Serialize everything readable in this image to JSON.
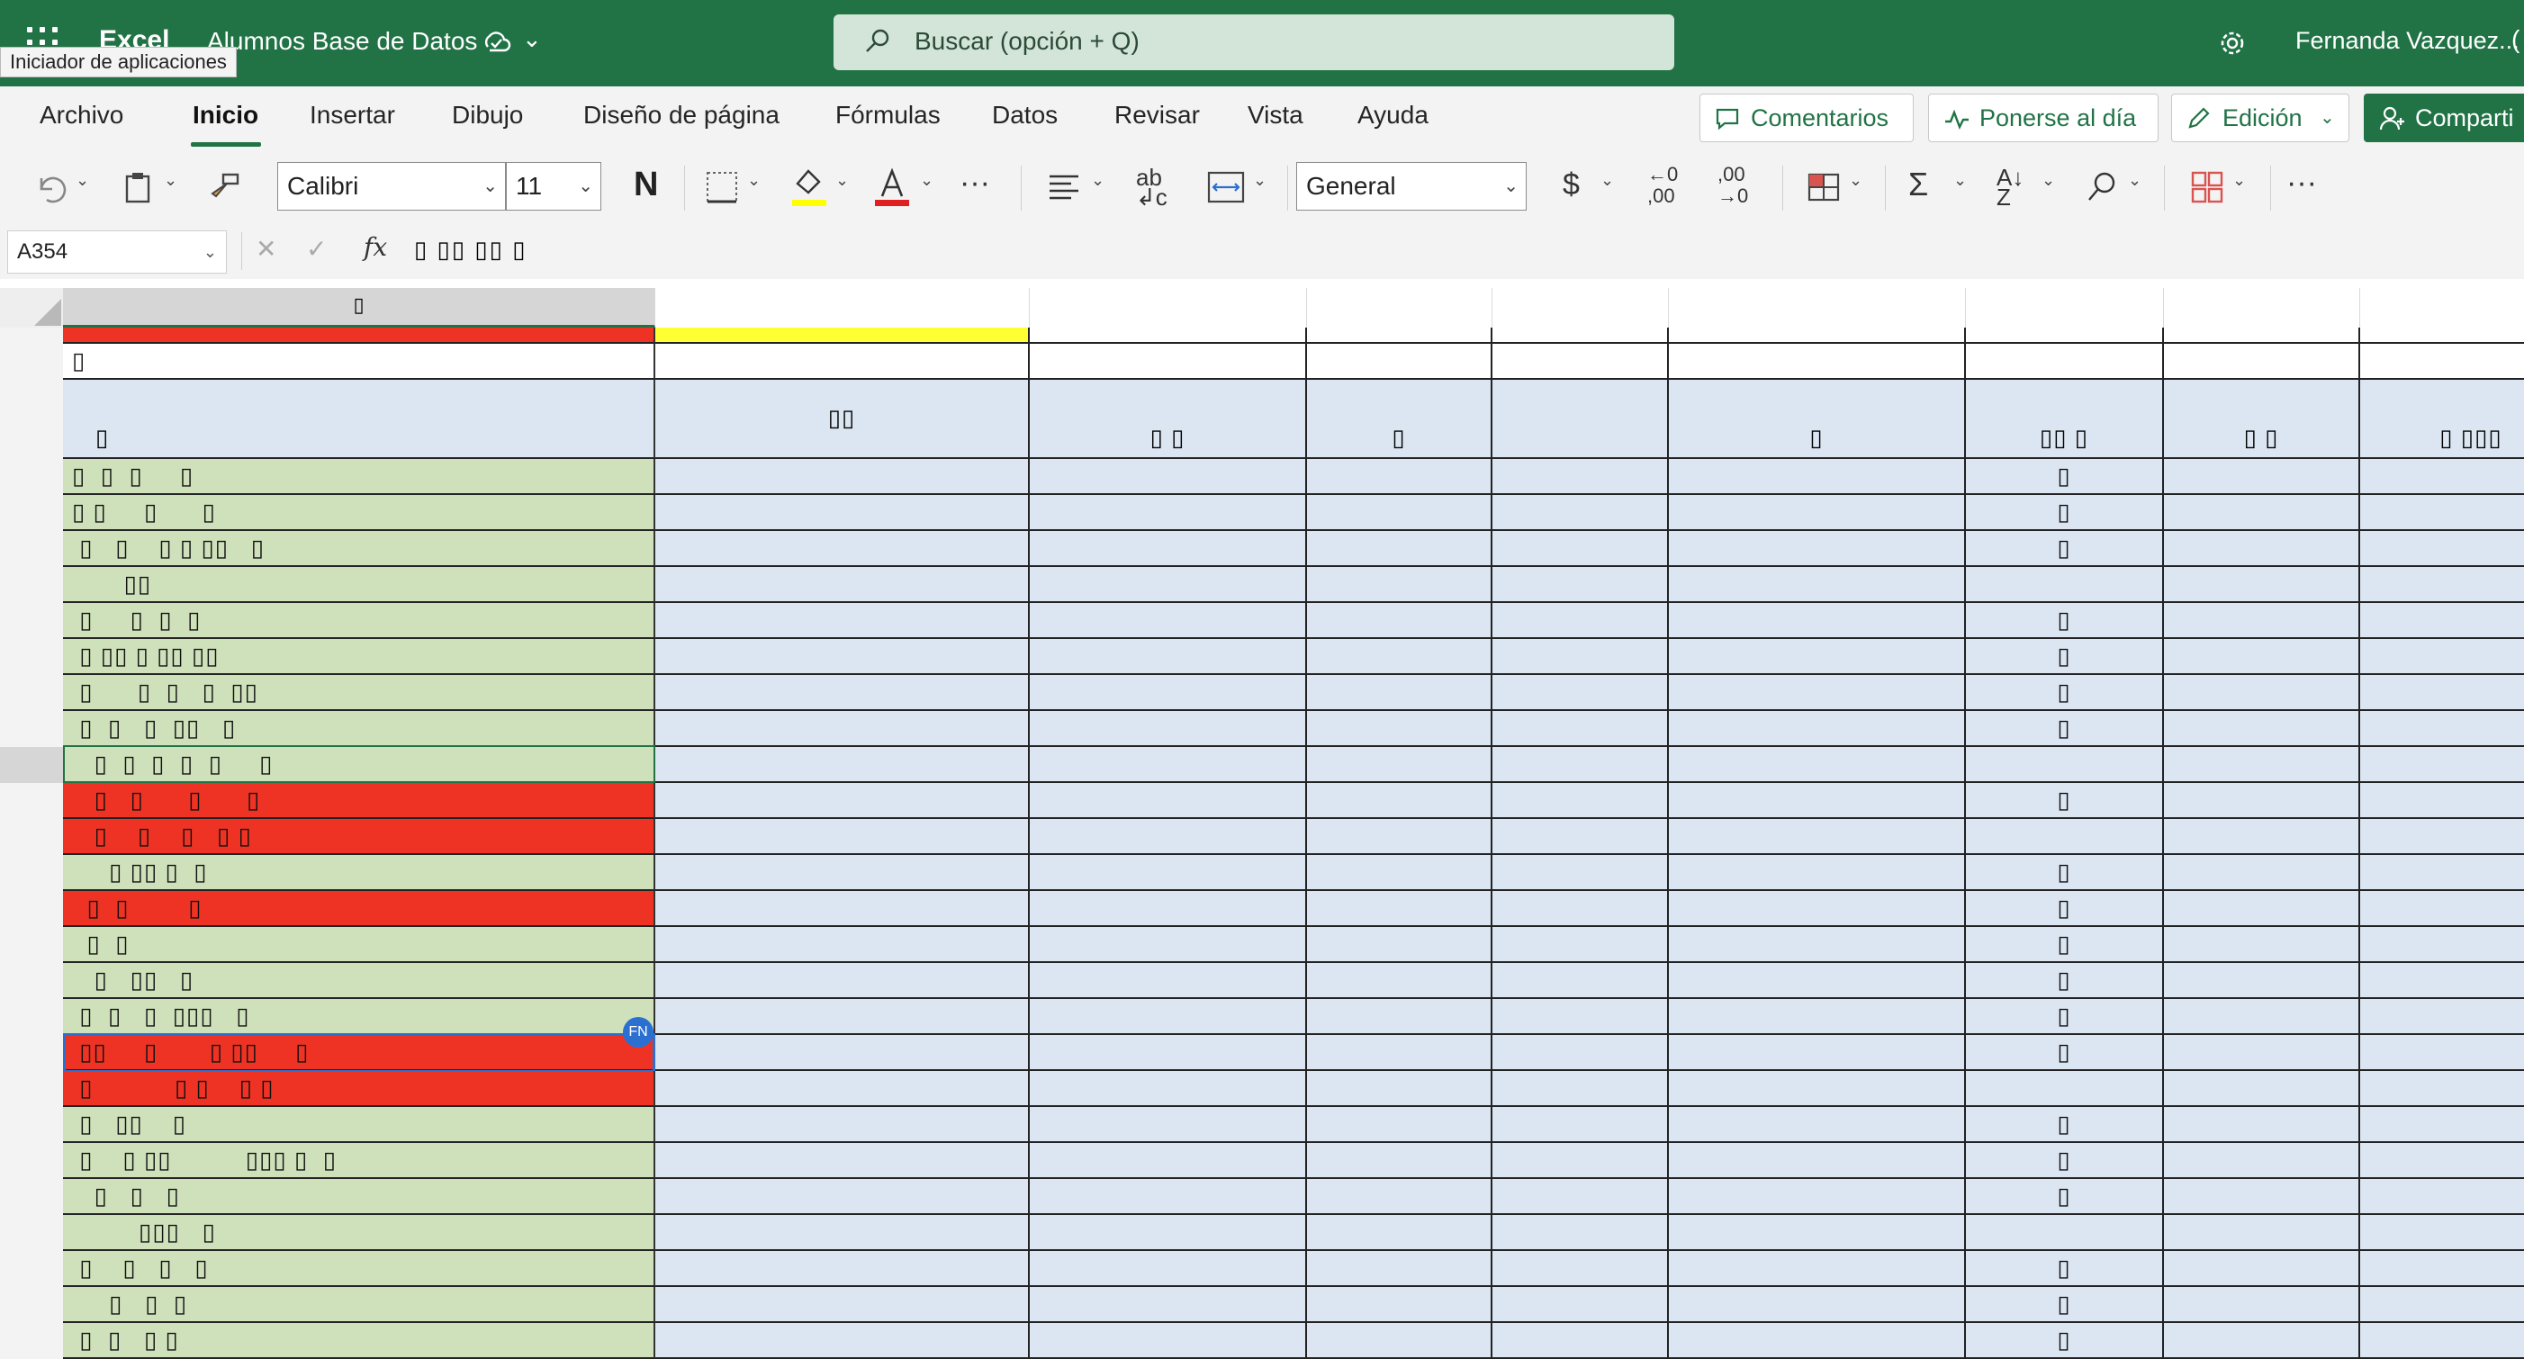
{
  "app": {
    "name": "Excel",
    "document_title": "Alumnos Base de Datos",
    "launcher_tooltip": "Iniciador de aplicaciones",
    "search_placeholder": "Buscar (opción + Q)",
    "user_name": "Fernanda Vazquez...",
    "user_paren": "(",
    "brand_color": "#217346"
  },
  "ribbon": {
    "tabs": [
      "Archivo",
      "Inicio",
      "Insertar",
      "Dibujo",
      "Diseño de página",
      "Fórmulas",
      "Datos",
      "Revisar",
      "Vista",
      "Ayuda"
    ],
    "active_tab": "Inicio",
    "comments_label": "Comentarios",
    "catchup_label": "Ponerse al día",
    "editing_label": "Edición",
    "share_label": "Comparti"
  },
  "toolbar": {
    "font_name": "Calibri",
    "font_size": "11",
    "bold_label": "N",
    "number_format": "General",
    "currency_symbol": "$",
    "increase_decimal": "←0\n,00",
    "decrease_decimal": ",00\n→0",
    "more_label": "···",
    "fill_color": "#ffff00",
    "font_color": "#e02020"
  },
  "formula_bar": {
    "name_box": "A354",
    "fx_label": "fx",
    "content": "▯ ▯▯ ▯▯ ▯"
  },
  "sheet": {
    "colors": {
      "green": "#cfe1bb",
      "red": "#ee3324",
      "blue": "#dce6f2",
      "yellow": "#ffff33",
      "white": "#ffffff"
    },
    "col_a_header_glyph": "▯",
    "title_row_glyph": "▯",
    "header_row": [
      "▯",
      "▯▯",
      "▯ ▯",
      "▯",
      "",
      "▯",
      "▯▯ ▯",
      "▯ ▯",
      "▯ ▯▯▯"
    ],
    "rows": [
      {
        "fill": "green",
        "a": "▯  ▯  ▯     ▯",
        "g": "▯"
      },
      {
        "fill": "green",
        "a": "▯ ▯     ▯      ▯",
        "g": "▯"
      },
      {
        "fill": "green",
        "a": " ▯   ▯    ▯ ▯ ▯▯   ▯",
        "g": "▯"
      },
      {
        "fill": "green",
        "a": "       ▯▯",
        "g": ""
      },
      {
        "fill": "green",
        "a": " ▯     ▯  ▯  ▯",
        "g": "▯"
      },
      {
        "fill": "green",
        "a": " ▯ ▯▯ ▯ ▯▯ ▯▯",
        "g": "▯"
      },
      {
        "fill": "green",
        "a": " ▯      ▯  ▯   ▯  ▯▯",
        "g": "▯"
      },
      {
        "fill": "green",
        "a": " ▯  ▯   ▯  ▯▯   ▯",
        "g": "▯"
      },
      {
        "fill": "green",
        "a": "   ▯  ▯  ▯  ▯  ▯     ▯",
        "g": ""
      },
      {
        "fill": "red",
        "a": "   ▯   ▯      ▯      ▯",
        "g": "▯"
      },
      {
        "fill": "red",
        "a": "   ▯    ▯    ▯   ▯ ▯",
        "g": ""
      },
      {
        "fill": "green",
        "a": "     ▯ ▯▯ ▯  ▯",
        "g": "▯"
      },
      {
        "fill": "red",
        "a": "  ▯  ▯        ▯",
        "g": "▯"
      },
      {
        "fill": "green",
        "a": "  ▯  ▯",
        "g": "▯"
      },
      {
        "fill": "green",
        "a": "   ▯   ▯▯   ▯",
        "g": "▯"
      },
      {
        "fill": "green",
        "a": " ▯  ▯   ▯  ▯▯▯   ▯",
        "g": "▯"
      },
      {
        "fill": "red",
        "a": " ▯▯     ▯       ▯ ▯▯     ▯",
        "g": "▯"
      },
      {
        "fill": "red",
        "a": " ▯           ▯ ▯    ▯ ▯",
        "g": ""
      },
      {
        "fill": "green",
        "a": " ▯   ▯▯    ▯",
        "g": "▯"
      },
      {
        "fill": "green",
        "a": " ▯    ▯ ▯▯          ▯▯▯ ▯  ▯",
        "g": "▯"
      },
      {
        "fill": "green",
        "a": "   ▯   ▯   ▯",
        "g": "▯"
      },
      {
        "fill": "green",
        "a": "         ▯▯▯   ▯",
        "g": ""
      },
      {
        "fill": "green",
        "a": " ▯    ▯   ▯   ▯",
        "g": "▯"
      },
      {
        "fill": "green",
        "a": "     ▯   ▯  ▯",
        "g": "▯"
      },
      {
        "fill": "green",
        "a": " ▯  ▯   ▯ ▯",
        "g": "▯"
      }
    ],
    "selected_row_index": 8,
    "active_row_index": 16,
    "active_user_initials": "FN"
  }
}
